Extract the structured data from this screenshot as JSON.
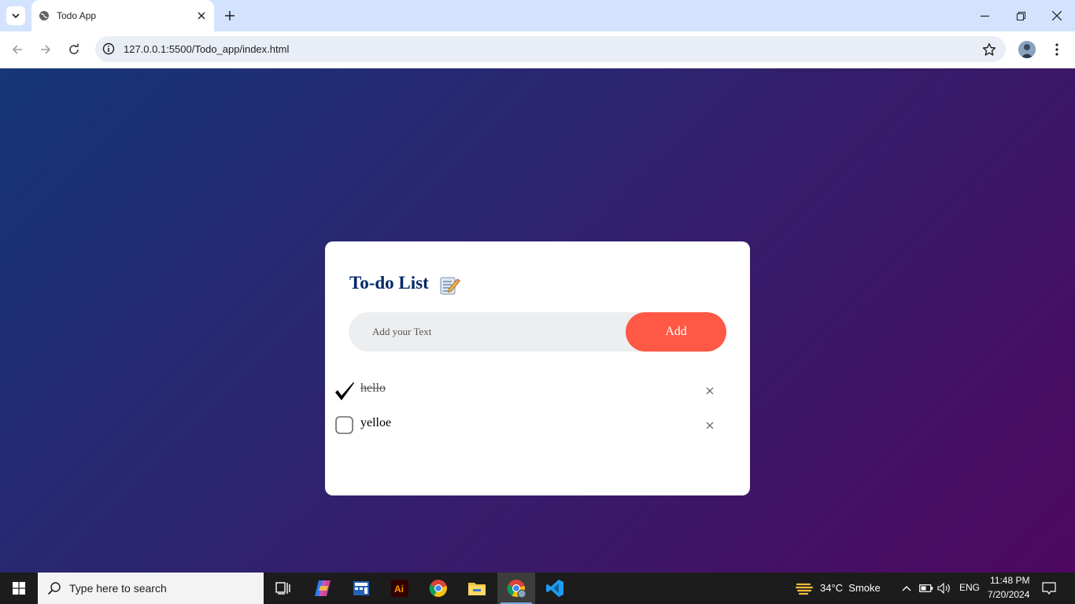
{
  "browser": {
    "tab_title": "Todo App",
    "url": "127.0.0.1:5500/Todo_app/index.html"
  },
  "app": {
    "title": "To-do List",
    "input_placeholder": "Add your Text",
    "add_label": "Add",
    "tasks": [
      {
        "text": "hello",
        "checked": true
      },
      {
        "text": "yelloe",
        "checked": false
      }
    ],
    "colors": {
      "accent": "#ff5945",
      "title": "#002765",
      "gradient_start": "#153677",
      "gradient_end": "#4e085f"
    }
  },
  "taskbar": {
    "search_placeholder": "Type here to search",
    "weather": "34°C  Smoke",
    "language": "ENG",
    "time": "11:48 PM",
    "date": "7/20/2024",
    "apps": [
      "task-view-icon",
      "copilot-icon",
      "calculator-icon",
      "illustrator-icon",
      "chrome-icon",
      "file-explorer-icon",
      "chrome-profile-icon",
      "vscode-icon"
    ]
  }
}
